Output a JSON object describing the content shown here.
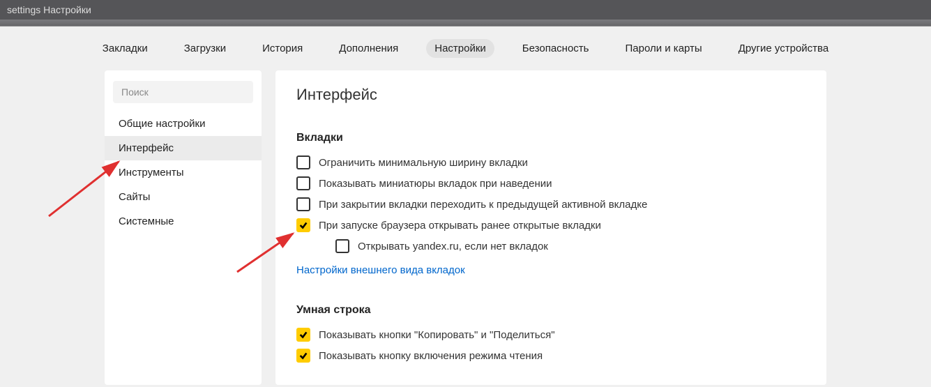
{
  "titlebar": {
    "text": "settings  Настройки"
  },
  "topnav": {
    "items": [
      {
        "label": "Закладки",
        "active": false
      },
      {
        "label": "Загрузки",
        "active": false
      },
      {
        "label": "История",
        "active": false
      },
      {
        "label": "Дополнения",
        "active": false
      },
      {
        "label": "Настройки",
        "active": true
      },
      {
        "label": "Безопасность",
        "active": false
      },
      {
        "label": "Пароли и карты",
        "active": false
      },
      {
        "label": "Другие устройства",
        "active": false
      }
    ]
  },
  "sidebar": {
    "search_placeholder": "Поиск",
    "items": [
      {
        "label": "Общие настройки",
        "active": false
      },
      {
        "label": "Интерфейс",
        "active": true
      },
      {
        "label": "Инструменты",
        "active": false
      },
      {
        "label": "Сайты",
        "active": false
      },
      {
        "label": "Системные",
        "active": false
      }
    ]
  },
  "content": {
    "title": "Интерфейс",
    "sections": {
      "tabs": {
        "title": "Вкладки",
        "options": [
          {
            "label": "Ограничить минимальную ширину вкладки",
            "checked": false,
            "indent": false
          },
          {
            "label": "Показывать миниатюры вкладок при наведении",
            "checked": false,
            "indent": false
          },
          {
            "label": "При закрытии вкладки переходить к предыдущей активной вкладке",
            "checked": false,
            "indent": false
          },
          {
            "label": "При запуске браузера открывать ранее открытые вкладки",
            "checked": true,
            "indent": false
          },
          {
            "label": "Открывать yandex.ru, если нет вкладок",
            "checked": false,
            "indent": true
          }
        ],
        "link": "Настройки внешнего вида вкладок"
      },
      "smartline": {
        "title": "Умная строка",
        "options": [
          {
            "label": "Показывать кнопки \"Копировать\" и \"Поделиться\"",
            "checked": true,
            "indent": false
          },
          {
            "label": "Показывать кнопку включения режима чтения",
            "checked": true,
            "indent": false
          }
        ]
      }
    }
  }
}
